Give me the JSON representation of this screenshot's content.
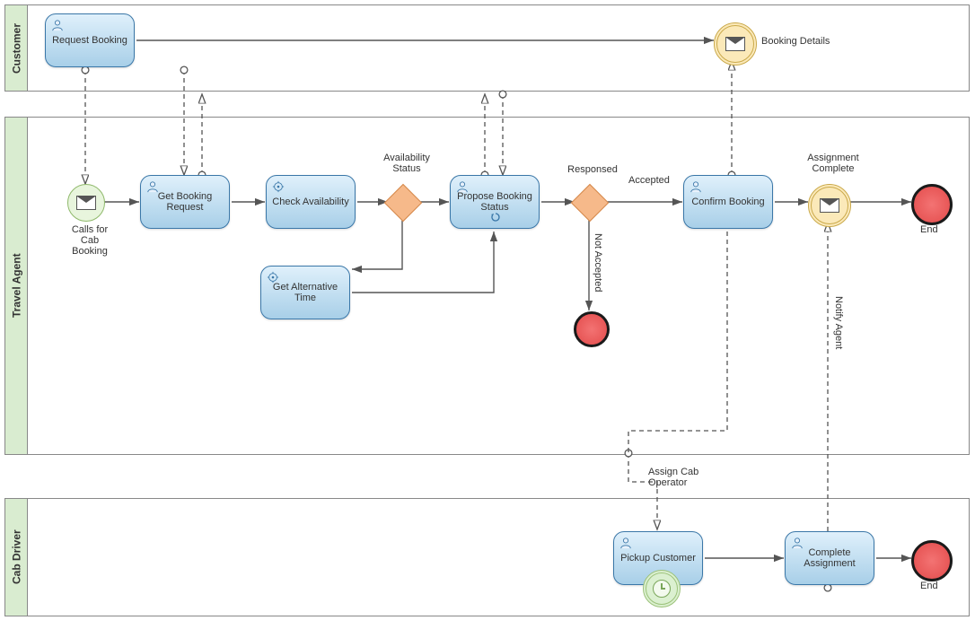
{
  "lanes": {
    "customer": "Customer",
    "travel_agent": "Travel Agent",
    "cab_driver": "Cab Driver"
  },
  "tasks": {
    "request_booking": "Request Booking",
    "get_booking_request": "Get Booking Request",
    "check_availability": "Check Availability",
    "propose_booking_status": "Propose Booking Status",
    "get_alternative_time": "Get Alternative Time",
    "confirm_booking": "Confirm Booking",
    "pickup_customer": "Pickup Customer",
    "complete_assignment": "Complete Assignment"
  },
  "gateways": {
    "availability_status": "Availability Status",
    "response": "Responsed"
  },
  "events": {
    "calls_for_cab_booking": "Calls for Cab Booking",
    "booking_details": "Booking Details",
    "assignment_complete": "Assignment Complete",
    "end1": "End",
    "end2": "End",
    "end_na": ""
  },
  "flow_labels": {
    "accepted": "Accepted",
    "not_accepted": "Not Accepted",
    "assign_cab_operator": "Assign Cab Operator",
    "notify_agent": "Notify Agent"
  }
}
